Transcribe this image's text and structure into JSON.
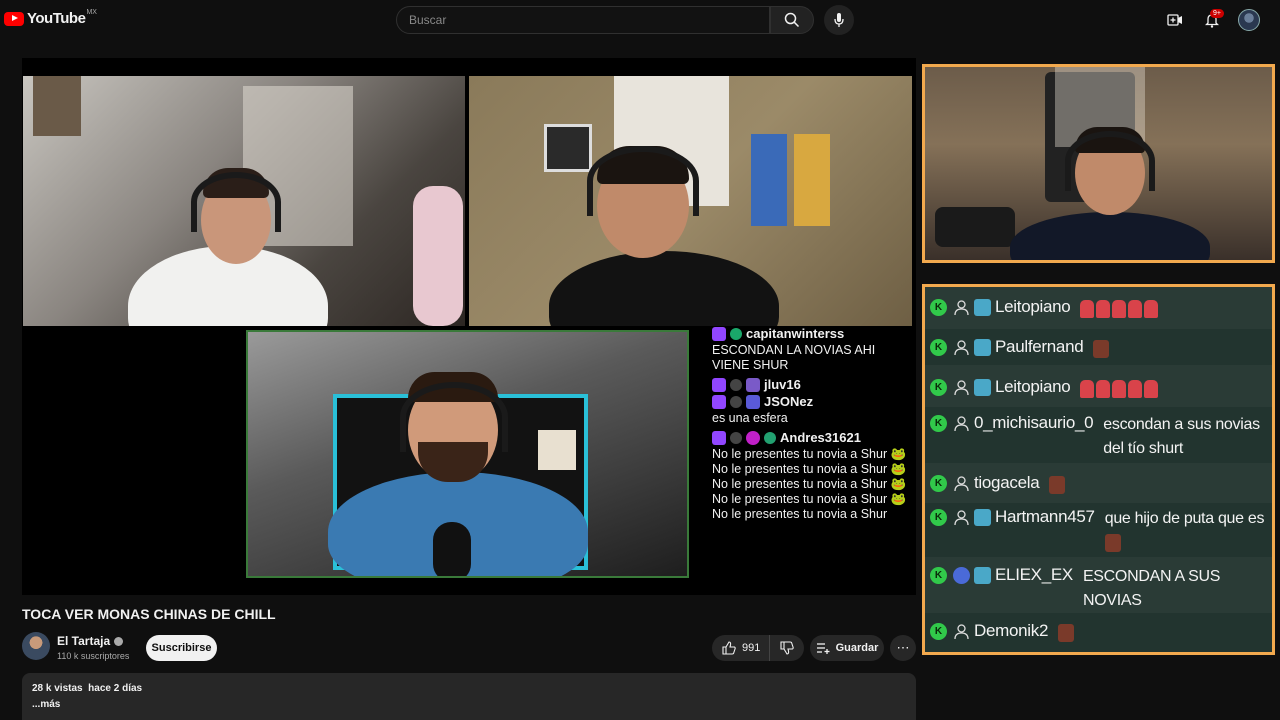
{
  "header": {
    "logo_text": "YouTube",
    "region": "MX",
    "search_placeholder": "Buscar",
    "notifications_badge": "9+"
  },
  "player_chat": {
    "messages": [
      {
        "user": "capitanwinterss",
        "text": "ESCONDAN LA NOVIAS AHI VIENE SHUR"
      },
      {
        "user": "jluv16",
        "text": ""
      },
      {
        "user": "JSONez",
        "text": "es una esfera"
      },
      {
        "user": "Andres31621",
        "text": "No le presentes tu novia a Shur 🐸 No le presentes tu novia a Shur 🐸 No le presentes tu novia a Shur 🐸 No le presentes tu novia a Shur 🐸 No le presentes tu novia a Shur"
      }
    ]
  },
  "video": {
    "title": "TOCA VER MONAS CHINAS DE CHILL",
    "channel_name": "El Tartaja",
    "subscribers": "110 k suscriptores",
    "subscribe_label": "Suscribirse",
    "likes": "991",
    "save_label": "Guardar",
    "more_label": "⋯",
    "views": "28 k vistas",
    "date": "hace 2 días",
    "more_desc": "...más"
  },
  "overlay_chat": [
    {
      "user": "Leitopiano",
      "msg": "",
      "emotes": 5,
      "face": false,
      "sub": true
    },
    {
      "user": "Paulfernand",
      "msg": "",
      "emotes": 0,
      "face": true,
      "sub": true
    },
    {
      "user": "Leitopiano",
      "msg": "",
      "emotes": 5,
      "face": false,
      "sub": true
    },
    {
      "user": "0_michisaurio_0",
      "msg": "escondan a sus novias del tío shurt",
      "emotes": 0,
      "face": false,
      "sub": false
    },
    {
      "user": "tiogacela",
      "msg": "",
      "emotes": 0,
      "face": true,
      "sub": false
    },
    {
      "user": "Hartmann457",
      "msg": "que hijo de puta que es",
      "emotes": 0,
      "face": true,
      "sub": true
    },
    {
      "user": "ELIEX_EX",
      "msg": "ESCONDAN A SUS NOVIAS",
      "emotes": 0,
      "face": false,
      "sub": true
    },
    {
      "user": "Demonik2",
      "msg": "",
      "emotes": 0,
      "face": true,
      "sub": false
    }
  ],
  "colors": {
    "accent_red": "#ff0000",
    "overlay_border": "#f2a94e",
    "chat_bg": "#2a3b36",
    "k_badge": "#31c94a",
    "twitch": "#9146ff"
  }
}
